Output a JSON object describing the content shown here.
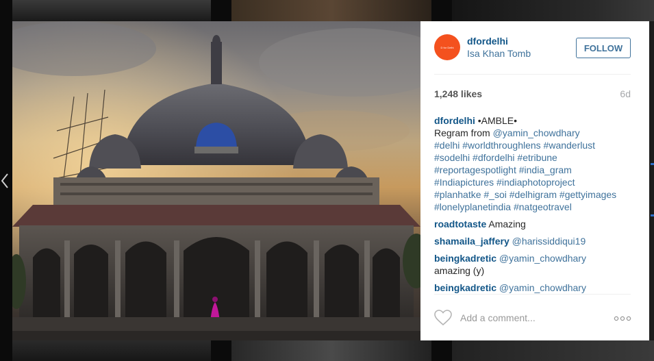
{
  "post": {
    "username": "dfordelhi",
    "location": "Isa Khan Tomb",
    "avatar_text": "D for Delhi",
    "follow_label": "FOLLOW",
    "likes": "1,248 likes",
    "age": "6d",
    "caption": {
      "user": "dfordelhi",
      "title": "•AMBLE•",
      "regram_prefix": "Regram from",
      "regram_mention": "@yamin_chowdhary",
      "hashtag_lines": [
        "#delhi #worldthroughlens #wanderlust",
        "#sodelhi #dfordelhi #etribune",
        "#reportagespotlight #india_gram",
        "#Indiapictures #indiaphotoproject",
        "#planhatke #_soi #delhigram #gettyimages",
        "#lonelyplanetindia #natgeotravel"
      ]
    },
    "comments": [
      {
        "user": "roadtotaste",
        "text": "Amazing"
      },
      {
        "user": "shamaila_jaffery",
        "mention": "@harissiddiqui19"
      },
      {
        "user": "beingkadretic",
        "mention": "@yamin_chowdhary",
        "text": "amazing (y)"
      },
      {
        "user": "beingkadretic",
        "mention": "@yamin_chowdhary"
      }
    ],
    "add_comment_placeholder": "Add a comment...",
    "like_icon": "heart-outline-icon",
    "more_icon": "ellipsis-icon",
    "nav_prev_icon": "chevron-left-icon"
  },
  "colors": {
    "username": "#125688",
    "link": "#3f729b",
    "avatar": "#f4511e",
    "meta": "#a5a7aa"
  }
}
